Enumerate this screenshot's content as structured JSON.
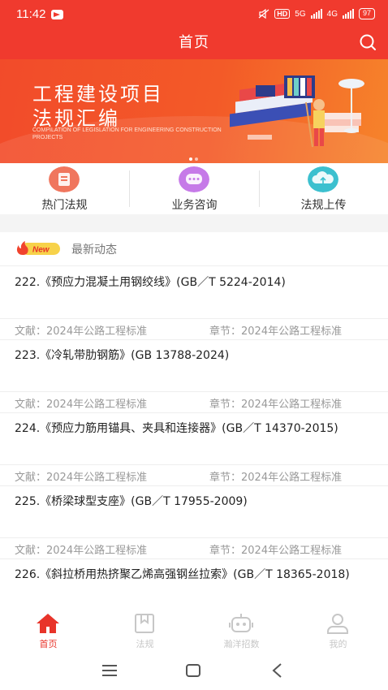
{
  "status_bar": {
    "time": "11:42",
    "hd": "HD",
    "net1": "5G",
    "net2": "4G",
    "battery": "97"
  },
  "header": {
    "title": "首页",
    "search_icon": "search-icon"
  },
  "banner": {
    "title_line1": "工程建设项目",
    "title_line2": "法规汇编",
    "subtitle": "COMPILATION OF LEGISLATION FOR ENGINEERING CONSTRUCTION PROJECTS",
    "slides": 2,
    "active_slide": 1
  },
  "quick_links": [
    {
      "label": "热门法规",
      "icon": "hot-regulations-icon",
      "color": "#f0765e"
    },
    {
      "label": "业务咨询",
      "icon": "consult-chat-icon",
      "color": "#c67ae8"
    },
    {
      "label": "法规上传",
      "icon": "upload-cloud-icon",
      "color": "#3cc0cf"
    }
  ],
  "latest": {
    "badge": "New",
    "title": "最新动态",
    "items": [
      {
        "title": "222.《预应力混凝土用钢绞线》(GB／T 5224-2014)",
        "doc": "文献：2024年公路工程标准",
        "chapter": "章节：2024年公路工程标准"
      },
      {
        "title": "223.《冷轧带肋钢筋》(GB 13788-2024)",
        "doc": "文献：2024年公路工程标准",
        "chapter": "章节：2024年公路工程标准"
      },
      {
        "title": "224.《预应力筋用锚具、夹具和连接器》(GB／T 14370-2015)",
        "doc": "文献：2024年公路工程标准",
        "chapter": "章节：2024年公路工程标准"
      },
      {
        "title": "225.《桥梁球型支座》(GB／T 17955-2009)",
        "doc": "文献：2024年公路工程标准",
        "chapter": "章节：2024年公路工程标准"
      },
      {
        "title": "226.《斜拉桥用热挤聚乙烯高强钢丝拉索》(GB／T 18365-2018)",
        "doc": "",
        "chapter": ""
      }
    ]
  },
  "tabbar": [
    {
      "label": "首页",
      "icon": "home-icon",
      "active": true
    },
    {
      "label": "法规",
      "icon": "regulations-book-icon",
      "active": false
    },
    {
      "label": "瀚洋招数",
      "icon": "robot-icon",
      "active": false
    },
    {
      "label": "我的",
      "icon": "profile-icon",
      "active": false
    }
  ],
  "colors": {
    "primary": "#f03a2e",
    "active_tab": "#e8342a",
    "muted": "#999999"
  }
}
